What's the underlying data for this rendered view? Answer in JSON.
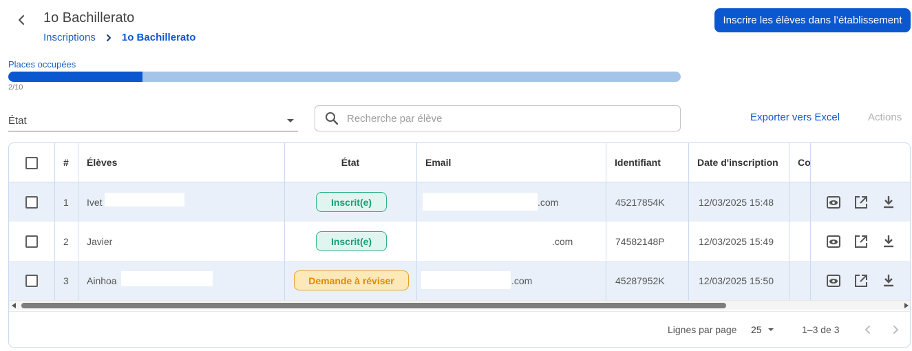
{
  "header": {
    "title": "1o Bachillerato",
    "breadcrumb": {
      "parent": "Inscriptions",
      "current": "1o Bachillerato"
    },
    "enroll_button": "Inscrire les élèves dans l’établissement"
  },
  "capacity": {
    "label": "Places occupées",
    "count_text": "2/10",
    "fraction": 0.2
  },
  "filters": {
    "state_label": "État",
    "search_placeholder": "Recherche par élève",
    "export_label": "Exporter vers Excel",
    "actions_label": "Actions"
  },
  "table": {
    "headers": {
      "index": "#",
      "student": "Élèves",
      "state": "État",
      "email": "Email",
      "id": "Identifiant",
      "date": "Date d'inscription",
      "extra": "Co"
    },
    "rows": [
      {
        "index": "1",
        "student": "Ivet",
        "state": "Inscrit(e)",
        "state_kind": "ok",
        "email": ".com",
        "id": "45217854K",
        "date": "12/03/2025 15:48"
      },
      {
        "index": "2",
        "student": "Javier",
        "state": "Inscrit(e)",
        "state_kind": "ok",
        "email": ".com",
        "id": "74582148P",
        "date": "12/03/2025 15:49"
      },
      {
        "index": "3",
        "student": "Ainhoa",
        "state": "Demande à réviser",
        "state_kind": "warn",
        "email": ".com",
        "id": "45287952K",
        "date": "12/03/2025 15:50"
      }
    ]
  },
  "pagination": {
    "rows_label": "Lignes par page",
    "rows_value": "25",
    "range": "1–3 de 3"
  },
  "colors": {
    "accent": "#0b57d0",
    "track": "#a5c4ea",
    "row_alt": "#e9f0f9",
    "ok": "#1a9e78",
    "warn": "#e08a00"
  }
}
